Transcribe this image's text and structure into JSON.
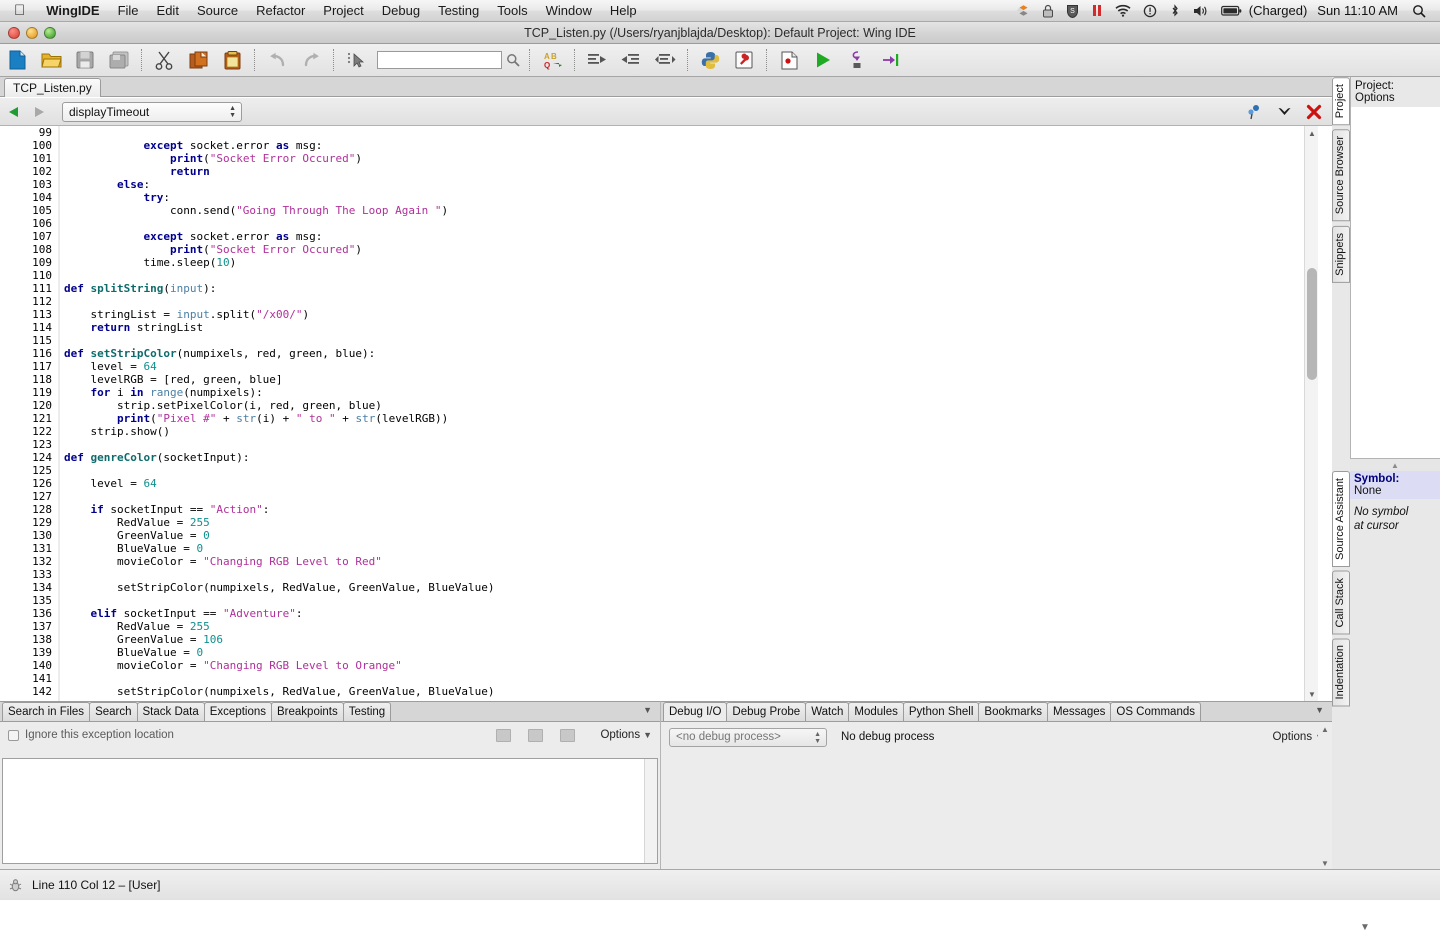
{
  "menubar": {
    "apple_icon": "apple-logo-icon",
    "items": [
      {
        "label": "WingIDE",
        "bold": true
      },
      {
        "label": "File",
        "bold": false
      },
      {
        "label": "Edit",
        "bold": false
      },
      {
        "label": "Source",
        "bold": false
      },
      {
        "label": "Refactor",
        "bold": false
      },
      {
        "label": "Project",
        "bold": false
      },
      {
        "label": "Debug",
        "bold": false
      },
      {
        "label": "Testing",
        "bold": false
      },
      {
        "label": "Tools",
        "bold": false
      },
      {
        "label": "Window",
        "bold": false
      },
      {
        "label": "Help",
        "bold": false
      }
    ],
    "status_icons": [
      "dropbox-icon",
      "lock-icon",
      "sophos-shield-icon",
      "pause-icon",
      "wifi-icon",
      "alert-icon",
      "bluetooth-icon",
      "volume-icon"
    ],
    "battery_icon": "battery-icon",
    "battery_label": "(Charged)",
    "clock": "Sun 11:10 AM",
    "spotlight_icon": "search-icon"
  },
  "window": {
    "title": "TCP_Listen.py (/Users/ryanjblajda/Desktop): Default Project: Wing IDE",
    "controls": [
      "close-button",
      "minimize-button",
      "zoom-button"
    ]
  },
  "toolbar": {
    "buttons": [
      {
        "name": "new-file-button",
        "icon": "new-file-icon"
      },
      {
        "name": "open-file-button",
        "icon": "open-folder-icon"
      },
      {
        "name": "save-button",
        "icon": "save-disk-icon"
      },
      {
        "name": "save-all-button",
        "icon": "save-all-icon"
      },
      {
        "name": "cut-button",
        "icon": "scissors-icon"
      },
      {
        "name": "copy-button",
        "icon": "copy-icon"
      },
      {
        "name": "paste-button",
        "icon": "clipboard-paste-icon"
      },
      {
        "name": "undo-button",
        "icon": "undo-arrow-icon"
      },
      {
        "name": "redo-button",
        "icon": "redo-arrow-icon"
      },
      {
        "name": "select-button",
        "icon": "cursor-select-icon"
      }
    ],
    "search_value": "",
    "search_icon": "magnifier-icon",
    "buttons2": [
      {
        "name": "replace-button",
        "icon": "ab-replace-icon"
      },
      {
        "name": "indent-right-button",
        "icon": "indent-right-icon"
      },
      {
        "name": "indent-left-button",
        "icon": "indent-left-icon"
      },
      {
        "name": "indent-match-button",
        "icon": "indent-match-icon"
      },
      {
        "name": "python-shell-button",
        "icon": "python-logo-icon"
      },
      {
        "name": "debug-probe-button",
        "icon": "wrench-icon"
      },
      {
        "name": "toggle-breakpoint-button",
        "icon": "breakpoint-icon"
      },
      {
        "name": "run-button",
        "icon": "play-green-icon"
      },
      {
        "name": "step-into-button",
        "icon": "step-into-icon"
      },
      {
        "name": "step-over-button",
        "icon": "step-over-icon"
      }
    ]
  },
  "editor": {
    "file_tab": "TCP_Listen.py",
    "nav_back_icon": "arrow-left-icon",
    "nav_forward_icon": "arrow-right-icon",
    "symbol_select_value": "displayTimeout",
    "right_icons": [
      {
        "name": "split-view-button",
        "icon": "split-view-icon"
      },
      {
        "name": "editor-menu-button",
        "icon": "chevron-down-icon"
      },
      {
        "name": "close-editor-button",
        "icon": "close-x-icon"
      }
    ],
    "first_line": 99,
    "fold_lines": [
      100,
      103,
      104,
      107,
      111,
      116,
      119,
      124,
      128,
      136
    ],
    "lines": [
      {
        "n": 99,
        "tokens": []
      },
      {
        "n": 100,
        "tokens": [
          {
            "t": "            ",
            "c": "pl"
          },
          {
            "t": "except",
            "c": "kw"
          },
          {
            "t": " socket.error ",
            "c": "pl"
          },
          {
            "t": "as",
            "c": "kw"
          },
          {
            "t": " msg:",
            "c": "pl"
          }
        ]
      },
      {
        "n": 101,
        "tokens": [
          {
            "t": "                ",
            "c": "pl"
          },
          {
            "t": "print",
            "c": "kw"
          },
          {
            "t": "(",
            "c": "pl"
          },
          {
            "t": "\"Socket Error Occured\"",
            "c": "str"
          },
          {
            "t": ")",
            "c": "pl"
          }
        ]
      },
      {
        "n": 102,
        "tokens": [
          {
            "t": "                ",
            "c": "pl"
          },
          {
            "t": "return",
            "c": "kw"
          }
        ]
      },
      {
        "n": 103,
        "tokens": [
          {
            "t": "        ",
            "c": "pl"
          },
          {
            "t": "else",
            "c": "kw"
          },
          {
            "t": ":",
            "c": "pl"
          }
        ]
      },
      {
        "n": 104,
        "tokens": [
          {
            "t": "            ",
            "c": "pl"
          },
          {
            "t": "try",
            "c": "kw"
          },
          {
            "t": ":",
            "c": "pl"
          }
        ]
      },
      {
        "n": 105,
        "tokens": [
          {
            "t": "                conn.send(",
            "c": "pl"
          },
          {
            "t": "\"Going Through The Loop Again \"",
            "c": "str"
          },
          {
            "t": ")",
            "c": "pl"
          }
        ]
      },
      {
        "n": 106,
        "tokens": []
      },
      {
        "n": 107,
        "tokens": [
          {
            "t": "            ",
            "c": "pl"
          },
          {
            "t": "except",
            "c": "kw"
          },
          {
            "t": " socket.error ",
            "c": "pl"
          },
          {
            "t": "as",
            "c": "kw"
          },
          {
            "t": " msg:",
            "c": "pl"
          }
        ]
      },
      {
        "n": 108,
        "tokens": [
          {
            "t": "                ",
            "c": "pl"
          },
          {
            "t": "print",
            "c": "kw"
          },
          {
            "t": "(",
            "c": "pl"
          },
          {
            "t": "\"Socket Error Occured\"",
            "c": "str"
          },
          {
            "t": ")",
            "c": "pl"
          }
        ]
      },
      {
        "n": 109,
        "tokens": [
          {
            "t": "            time.sleep(",
            "c": "pl"
          },
          {
            "t": "10",
            "c": "num"
          },
          {
            "t": ")",
            "c": "pl"
          }
        ]
      },
      {
        "n": 110,
        "tokens": []
      },
      {
        "n": 111,
        "tokens": [
          {
            "t": "",
            "c": "pl"
          },
          {
            "t": "def",
            "c": "kw"
          },
          {
            "t": " ",
            "c": "pl"
          },
          {
            "t": "splitString",
            "c": "fn"
          },
          {
            "t": "(",
            "c": "pl"
          },
          {
            "t": "input",
            "c": "bi"
          },
          {
            "t": "):",
            "c": "pl"
          }
        ]
      },
      {
        "n": 112,
        "tokens": []
      },
      {
        "n": 113,
        "tokens": [
          {
            "t": "    stringList = ",
            "c": "pl"
          },
          {
            "t": "input",
            "c": "bi"
          },
          {
            "t": ".split(",
            "c": "pl"
          },
          {
            "t": "\"/x00/\"",
            "c": "str"
          },
          {
            "t": ")",
            "c": "pl"
          }
        ]
      },
      {
        "n": 114,
        "tokens": [
          {
            "t": "    ",
            "c": "pl"
          },
          {
            "t": "return",
            "c": "kw"
          },
          {
            "t": " stringList",
            "c": "pl"
          }
        ]
      },
      {
        "n": 115,
        "tokens": []
      },
      {
        "n": 116,
        "tokens": [
          {
            "t": "",
            "c": "pl"
          },
          {
            "t": "def",
            "c": "kw"
          },
          {
            "t": " ",
            "c": "pl"
          },
          {
            "t": "setStripColor",
            "c": "fn"
          },
          {
            "t": "(numpixels, red, green, blue):",
            "c": "pl"
          }
        ]
      },
      {
        "n": 117,
        "tokens": [
          {
            "t": "    level = ",
            "c": "pl"
          },
          {
            "t": "64",
            "c": "num"
          }
        ]
      },
      {
        "n": 118,
        "tokens": [
          {
            "t": "    levelRGB = [red, green, blue]",
            "c": "pl"
          }
        ]
      },
      {
        "n": 119,
        "tokens": [
          {
            "t": "    ",
            "c": "pl"
          },
          {
            "t": "for",
            "c": "kw"
          },
          {
            "t": " i ",
            "c": "pl"
          },
          {
            "t": "in",
            "c": "kw"
          },
          {
            "t": " ",
            "c": "pl"
          },
          {
            "t": "range",
            "c": "bi"
          },
          {
            "t": "(numpixels):",
            "c": "pl"
          }
        ]
      },
      {
        "n": 120,
        "tokens": [
          {
            "t": "        strip.setPixelColor(i, red, green, blue)",
            "c": "pl"
          }
        ]
      },
      {
        "n": 121,
        "tokens": [
          {
            "t": "        ",
            "c": "pl"
          },
          {
            "t": "print",
            "c": "kw"
          },
          {
            "t": "(",
            "c": "pl"
          },
          {
            "t": "\"Pixel #\"",
            "c": "str"
          },
          {
            "t": " + ",
            "c": "pl"
          },
          {
            "t": "str",
            "c": "bi"
          },
          {
            "t": "(i) + ",
            "c": "pl"
          },
          {
            "t": "\" to \"",
            "c": "str"
          },
          {
            "t": " + ",
            "c": "pl"
          },
          {
            "t": "str",
            "c": "bi"
          },
          {
            "t": "(levelRGB))",
            "c": "pl"
          }
        ]
      },
      {
        "n": 122,
        "tokens": [
          {
            "t": "    strip.show()",
            "c": "pl"
          }
        ]
      },
      {
        "n": 123,
        "tokens": []
      },
      {
        "n": 124,
        "tokens": [
          {
            "t": "",
            "c": "pl"
          },
          {
            "t": "def",
            "c": "kw"
          },
          {
            "t": " ",
            "c": "pl"
          },
          {
            "t": "genreColor",
            "c": "fn"
          },
          {
            "t": "(socketInput):",
            "c": "pl"
          }
        ]
      },
      {
        "n": 125,
        "tokens": []
      },
      {
        "n": 126,
        "tokens": [
          {
            "t": "    level = ",
            "c": "pl"
          },
          {
            "t": "64",
            "c": "num"
          }
        ]
      },
      {
        "n": 127,
        "tokens": []
      },
      {
        "n": 128,
        "tokens": [
          {
            "t": "    ",
            "c": "pl"
          },
          {
            "t": "if",
            "c": "kw"
          },
          {
            "t": " socketInput == ",
            "c": "pl"
          },
          {
            "t": "\"Action\"",
            "c": "str"
          },
          {
            "t": ":",
            "c": "pl"
          }
        ]
      },
      {
        "n": 129,
        "tokens": [
          {
            "t": "        RedValue = ",
            "c": "pl"
          },
          {
            "t": "255",
            "c": "num"
          }
        ]
      },
      {
        "n": 130,
        "tokens": [
          {
            "t": "        GreenValue = ",
            "c": "pl"
          },
          {
            "t": "0",
            "c": "num"
          }
        ]
      },
      {
        "n": 131,
        "tokens": [
          {
            "t": "        BlueValue = ",
            "c": "pl"
          },
          {
            "t": "0",
            "c": "num"
          }
        ]
      },
      {
        "n": 132,
        "tokens": [
          {
            "t": "        movieColor = ",
            "c": "pl"
          },
          {
            "t": "\"Changing RGB Level to Red\"",
            "c": "str"
          }
        ]
      },
      {
        "n": 133,
        "tokens": []
      },
      {
        "n": 134,
        "tokens": [
          {
            "t": "        setStripColor(numpixels, RedValue, GreenValue, BlueValue)",
            "c": "pl"
          }
        ]
      },
      {
        "n": 135,
        "tokens": []
      },
      {
        "n": 136,
        "tokens": [
          {
            "t": "    ",
            "c": "pl"
          },
          {
            "t": "elif",
            "c": "kw"
          },
          {
            "t": " socketInput == ",
            "c": "pl"
          },
          {
            "t": "\"Adventure\"",
            "c": "str"
          },
          {
            "t": ":",
            "c": "pl"
          }
        ]
      },
      {
        "n": 137,
        "tokens": [
          {
            "t": "        RedValue = ",
            "c": "pl"
          },
          {
            "t": "255",
            "c": "num"
          }
        ]
      },
      {
        "n": 138,
        "tokens": [
          {
            "t": "        GreenValue = ",
            "c": "pl"
          },
          {
            "t": "106",
            "c": "num"
          }
        ]
      },
      {
        "n": 139,
        "tokens": [
          {
            "t": "        BlueValue = ",
            "c": "pl"
          },
          {
            "t": "0",
            "c": "num"
          }
        ]
      },
      {
        "n": 140,
        "tokens": [
          {
            "t": "        movieColor = ",
            "c": "pl"
          },
          {
            "t": "\"Changing RGB Level to Orange\"",
            "c": "str"
          }
        ]
      },
      {
        "n": 141,
        "tokens": []
      },
      {
        "n": 142,
        "tokens": [
          {
            "t": "        setStripColor(numpixels, RedValue, GreenValue, BlueValue)",
            "c": "pl"
          }
        ]
      }
    ]
  },
  "right_panel": {
    "top_tabs": [
      {
        "label": "Project",
        "active": true
      },
      {
        "label": "Source Browser",
        "active": false
      },
      {
        "label": "Snippets",
        "active": false
      }
    ],
    "top_header": "Project: Options",
    "bottom_tabs": [
      {
        "label": "Source Assistant",
        "active": true
      },
      {
        "label": "Call Stack",
        "active": false
      },
      {
        "label": "Indentation",
        "active": false
      }
    ],
    "symbol_label": "Symbol:",
    "symbol_value": "None",
    "symbol_note": "No symbol\nat cursor"
  },
  "bottom_left": {
    "tabs": [
      {
        "label": "Search in Files",
        "active": false
      },
      {
        "label": "Search",
        "active": false
      },
      {
        "label": "Stack Data",
        "active": false
      },
      {
        "label": "Exceptions",
        "active": true
      },
      {
        "label": "Breakpoints",
        "active": false
      },
      {
        "label": "Testing",
        "active": false
      }
    ],
    "checkbox_label": "Ignore this exception location",
    "checkbox_checked": false,
    "toolbar_icons": [
      "expand-all-icon",
      "collapse-icon",
      "collapse-all-icon"
    ],
    "options_label": "Options",
    "dropdown_icon": "triangle-down-icon"
  },
  "bottom_right": {
    "tabs": [
      {
        "label": "Debug I/O",
        "active": true
      },
      {
        "label": "Debug Probe",
        "active": false
      },
      {
        "label": "Watch",
        "active": false
      },
      {
        "label": "Modules",
        "active": false
      },
      {
        "label": "Python Shell",
        "active": false
      },
      {
        "label": "Bookmarks",
        "active": false
      },
      {
        "label": "Messages",
        "active": false
      },
      {
        "label": "OS Commands",
        "active": false
      }
    ],
    "process_select_value": "<no debug process>",
    "process_status": "No debug process",
    "options_label": "Options",
    "dropdown_icon": "triangle-down-icon"
  },
  "statusbar": {
    "icon": "bug-icon",
    "text": "Line 110 Col 12 – [User]"
  },
  "colors": {
    "keyword": "#00008b",
    "function": "#0e6b6b",
    "string": "#b0309a",
    "number": "#0f8f8f",
    "builtin": "#4a7fa5",
    "fold_marker": "#0000cc",
    "symbol_highlight": "#dcdcf5"
  }
}
